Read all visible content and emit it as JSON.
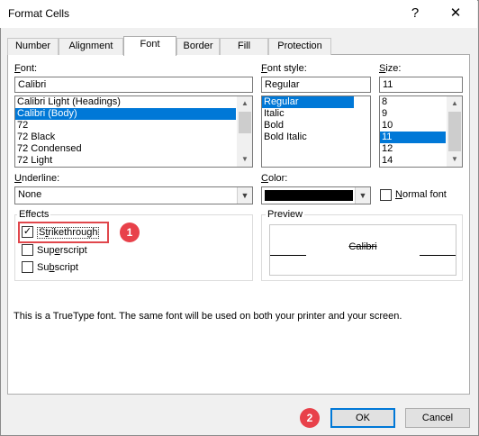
{
  "dialog": {
    "title": "Format Cells",
    "help_label": "?",
    "close_label": "✕"
  },
  "tabs": [
    {
      "label": "Number"
    },
    {
      "label": "Alignment"
    },
    {
      "label": "Font"
    },
    {
      "label": "Border"
    },
    {
      "label": "Fill"
    },
    {
      "label": "Protection"
    }
  ],
  "font": {
    "label_pre": "F",
    "label_post": "ont:",
    "value": "Calibri",
    "items": [
      "Calibri Light (Headings)",
      "Calibri (Body)",
      "72",
      "72 Black",
      "72 Condensed",
      "72 Light"
    ]
  },
  "font_style": {
    "label_pre": "F",
    "label_post": "ont style:",
    "value": "Regular",
    "items": [
      "Regular",
      "Italic",
      "Bold",
      "Bold Italic"
    ]
  },
  "size": {
    "label_pre": "S",
    "label_post": "ize:",
    "value": "11",
    "items": [
      "8",
      "9",
      "10",
      "11",
      "12",
      "14"
    ]
  },
  "underline": {
    "label_pre": "U",
    "label_post": "nderline:",
    "value": "None"
  },
  "color": {
    "label_pre": "C",
    "label_post": "olor:",
    "swatch": "#000000"
  },
  "normal_font": {
    "label_pre": "N",
    "label_post": "ormal font"
  },
  "effects": {
    "title": "Effects",
    "strikethrough": {
      "pre": "S",
      "mid": "t",
      "post": "rikethrough",
      "checked": "✓"
    },
    "superscript": {
      "pre": "Sup",
      "mid": "e",
      "post": "rscript"
    },
    "subscript": {
      "pre": "Su",
      "mid": "b",
      "post": "script"
    }
  },
  "preview": {
    "title": "Preview",
    "sample": "Calibri"
  },
  "info_text": "This is a TrueType font.  The same font will be used on both your printer and your screen.",
  "callouts": {
    "one": "1",
    "two": "2"
  },
  "buttons": {
    "ok": "OK",
    "cancel": "Cancel"
  },
  "colors": {
    "accent": "#0078d7",
    "callout": "#e8414a"
  }
}
